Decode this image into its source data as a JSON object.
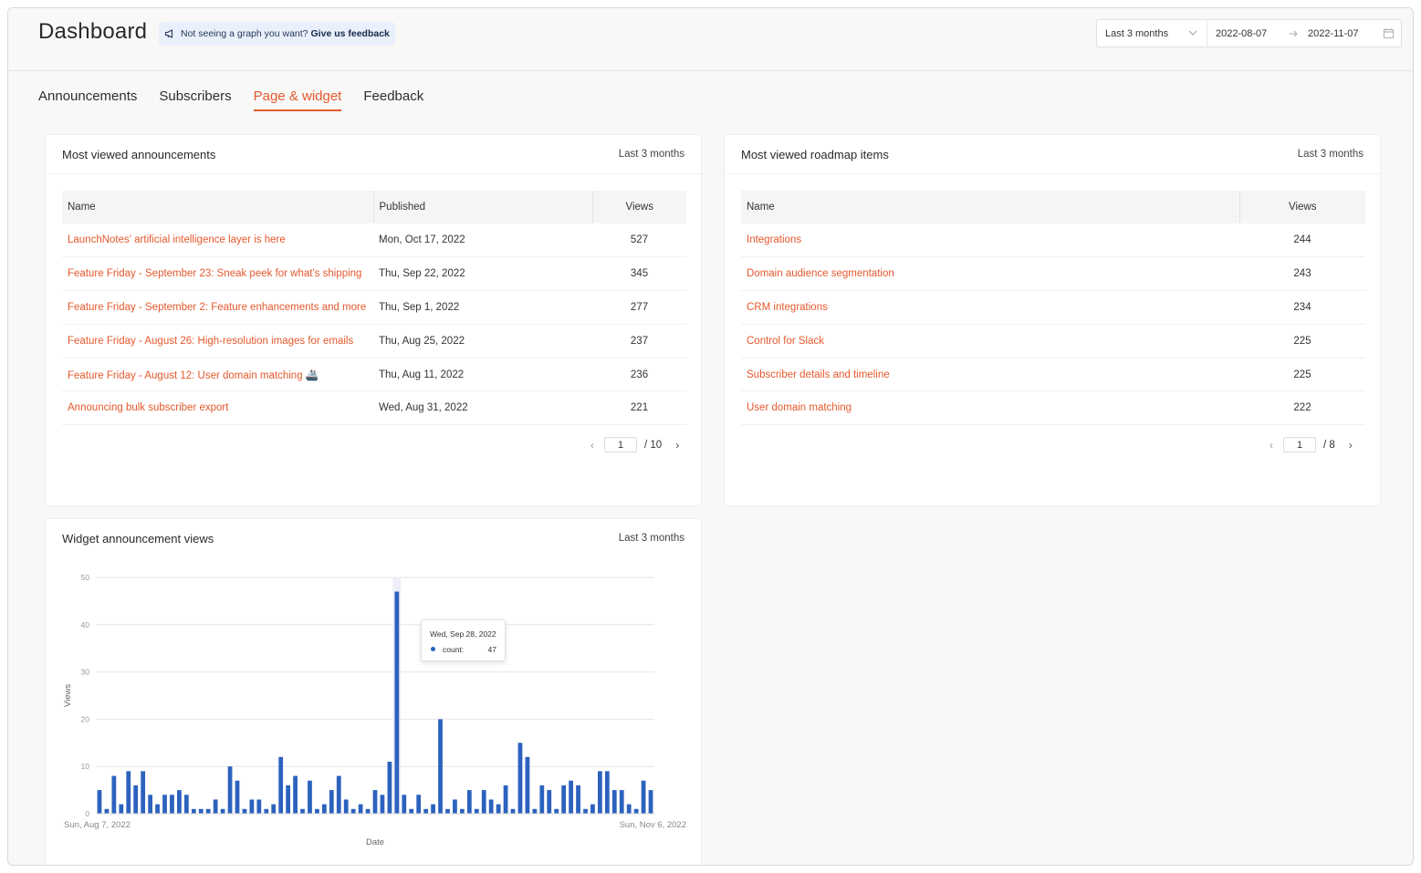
{
  "header": {
    "title": "Dashboard",
    "feedback_text": "Not seeing a graph you want?",
    "feedback_link": "Give us feedback",
    "range_select": "Last 3 months",
    "start_date": "2022-08-07",
    "end_date": "2022-11-07"
  },
  "tabs": [
    {
      "label": "Announcements",
      "active": false
    },
    {
      "label": "Subscribers",
      "active": false
    },
    {
      "label": "Page & widget",
      "active": true
    },
    {
      "label": "Feedback",
      "active": false
    }
  ],
  "colors": {
    "accent": "#e4592d",
    "bar": "#2c62be"
  },
  "announcements": {
    "title": "Most viewed announcements",
    "range": "Last 3 months",
    "columns": {
      "name": "Name",
      "published": "Published",
      "views": "Views"
    },
    "rows": [
      {
        "name": "LaunchNotes' artificial intelligence layer is here",
        "published": "Mon, Oct 17, 2022",
        "views": "527"
      },
      {
        "name": "Feature Friday - September 23: Sneak peek for what's shipping",
        "published": "Thu, Sep 22, 2022",
        "views": "345"
      },
      {
        "name": "Feature Friday - September 2: Feature enhancements and more",
        "published": "Thu, Sep 1, 2022",
        "views": "277"
      },
      {
        "name": "Feature Friday - August 26: High-resolution images for emails",
        "published": "Thu, Aug 25, 2022",
        "views": "237"
      },
      {
        "name": "Feature Friday - August 12: User domain matching 🚢",
        "published": "Thu, Aug 11, 2022",
        "views": "236"
      },
      {
        "name": "Announcing bulk subscriber export",
        "published": "Wed, Aug 31, 2022",
        "views": "221"
      }
    ],
    "pager": {
      "current": "1",
      "total": "/ 10"
    }
  },
  "roadmap": {
    "title": "Most viewed roadmap items",
    "range": "Last 3 months",
    "columns": {
      "name": "Name",
      "views": "Views"
    },
    "rows": [
      {
        "name": "Integrations",
        "views": "244"
      },
      {
        "name": "Domain audience segmentation",
        "views": "243"
      },
      {
        "name": "CRM integrations",
        "views": "234"
      },
      {
        "name": "Control for Slack",
        "views": "225"
      },
      {
        "name": "Subscriber details and timeline",
        "views": "225"
      },
      {
        "name": "User domain matching",
        "views": "222"
      }
    ],
    "pager": {
      "current": "1",
      "total": "/ 8"
    }
  },
  "widget": {
    "title": "Widget announcement views",
    "range": "Last 3 months",
    "tooltip": {
      "date": "Wed, Sep 28, 2022",
      "label": "count:",
      "value": "47"
    }
  },
  "chart_data": {
    "type": "bar",
    "title": "",
    "xlabel": "Date",
    "ylabel": "Views",
    "ylim": [
      0,
      50
    ],
    "yticks": [
      "0",
      "10",
      "20",
      "30",
      "40",
      "50"
    ],
    "x_start_label": "Sun, Aug 7, 2022",
    "x_end_label": "Sun, Nov 6, 2022",
    "grid": true,
    "series": [
      {
        "values": [
          5,
          1,
          8,
          2,
          9,
          6,
          9,
          4,
          2,
          4,
          4,
          5,
          4,
          1,
          1,
          1,
          3,
          1,
          10,
          7,
          1,
          3,
          3,
          1,
          2,
          12,
          6,
          8,
          1,
          7,
          1,
          2,
          5,
          8,
          3,
          1,
          2,
          1,
          5,
          4,
          11,
          47,
          4,
          1,
          4,
          1,
          2,
          20,
          1,
          3,
          1,
          5,
          1,
          5,
          3,
          2,
          6,
          1,
          15,
          12,
          1,
          6,
          5,
          1,
          6,
          7,
          6,
          1,
          2,
          9,
          9,
          5,
          5,
          2,
          1,
          7,
          5
        ]
      }
    ]
  }
}
